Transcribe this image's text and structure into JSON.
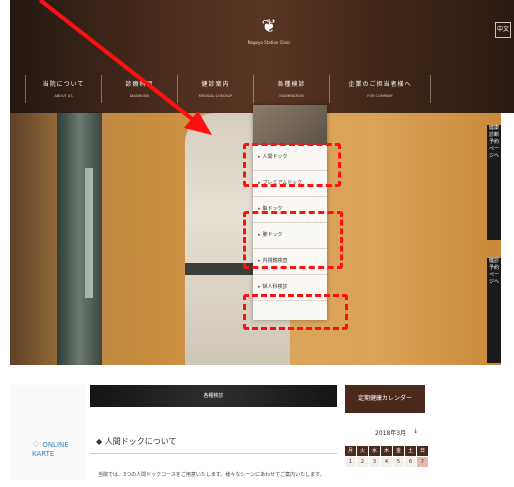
{
  "header": {
    "logo_text": "Nagoya Station Clinic",
    "lang_label": "中文",
    "nav": [
      {
        "jp": "当院について",
        "en": "ABOUT US"
      },
      {
        "jp": "診療科目",
        "en": "DIAGNOSIS"
      },
      {
        "jp": "健診案内",
        "en": "MEDICAL CHECKUP"
      },
      {
        "jp": "各種検診",
        "en": "EXAMINATION"
      },
      {
        "jp": "企業のご担当者様へ",
        "en": "FOR COMPANY"
      }
    ]
  },
  "dropdown": {
    "items": [
      "人間ドック",
      "プレミアムドック",
      "脳ドック",
      "肺ドック",
      "内視鏡検査",
      "婦人科検診"
    ]
  },
  "side_tabs": [
    "健康診断予約ページへ",
    "健診予約ページへ"
  ],
  "karte": {
    "label": "ONLINE KARTE"
  },
  "content": {
    "section_title": "各種検診",
    "heading": "人間ドックについて",
    "body": "当院では、3つの人間ドックコースをご用意いたします。様々なシーンにあわせてご案内いたします。"
  },
  "calendar": {
    "title": "定期健康カレンダー",
    "month": "2018年3月",
    "next": "↓",
    "weekdays": [
      "月",
      "火",
      "水",
      "木",
      "金",
      "土",
      "日"
    ],
    "days": [
      "1",
      "2",
      "3",
      "4",
      "5",
      "6",
      "7"
    ]
  },
  "colors": {
    "highlight": "#ff1010",
    "brand_brown": "#4b2a1d"
  }
}
